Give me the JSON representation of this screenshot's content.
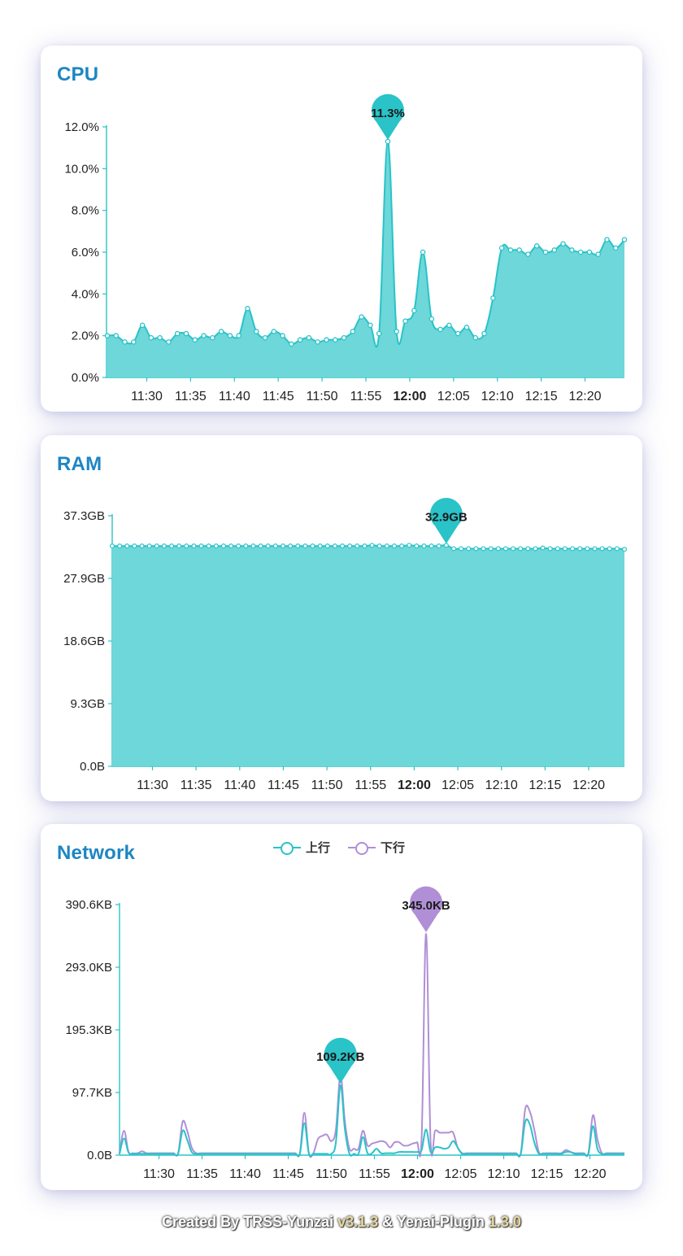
{
  "colors": {
    "cpu": "#29c3c8",
    "ram": "#29c3c8",
    "up": "#29c3c8",
    "down": "#b08fd6",
    "fill": "#6dd7d9",
    "title": "#1d86c3"
  },
  "chart_data": [
    {
      "id": "cpu",
      "type": "area",
      "title": "CPU",
      "xticks": [
        "11:30",
        "11:35",
        "11:40",
        "11:45",
        "11:50",
        "11:55",
        "12:00",
        "12:05",
        "12:10",
        "12:15",
        "12:20"
      ],
      "bold_tick": "12:00",
      "yticks": [
        "0.0%",
        "2.0%",
        "4.0%",
        "6.0%",
        "8.0%",
        "10.0%",
        "12.0%"
      ],
      "ylim": [
        0,
        12
      ],
      "x_start_min": 685.5,
      "x_step_min": 1,
      "values": [
        2.0,
        2.0,
        1.7,
        1.7,
        2.5,
        1.9,
        1.9,
        1.7,
        2.1,
        2.1,
        1.8,
        2.0,
        1.9,
        2.2,
        2.0,
        2.0,
        3.3,
        2.2,
        1.9,
        2.2,
        2.0,
        1.6,
        1.8,
        1.9,
        1.7,
        1.8,
        1.8,
        1.9,
        2.2,
        2.9,
        2.5,
        2.1,
        11.3,
        2.2,
        2.7,
        3.2,
        6.0,
        2.8,
        2.3,
        2.5,
        2.1,
        2.4,
        1.9,
        2.1,
        3.8,
        6.2,
        6.1,
        6.1,
        5.9,
        6.3,
        6.0,
        6.1,
        6.4,
        6.1,
        6.0,
        6.0,
        5.9,
        6.6,
        6.2,
        6.6
      ],
      "peak_label": "11.3%",
      "peak_index": 32,
      "peak_value": 11.3
    },
    {
      "id": "ram",
      "type": "area",
      "title": "RAM",
      "xticks": [
        "11:30",
        "11:35",
        "11:40",
        "11:45",
        "11:50",
        "11:55",
        "12:00",
        "12:05",
        "12:10",
        "12:15",
        "12:20"
      ],
      "bold_tick": "12:00",
      "yticks": [
        "0.0B",
        "9.3GB",
        "18.6GB",
        "27.9GB",
        "37.3GB"
      ],
      "ylim": [
        0,
        37.3
      ],
      "x_start_min": 685.5,
      "x_step_min": 1,
      "values": [
        32.8,
        32.8,
        32.8,
        32.8,
        32.8,
        32.8,
        32.8,
        32.8,
        32.8,
        32.8,
        32.8,
        32.8,
        32.8,
        32.8,
        32.8,
        32.8,
        32.8,
        32.8,
        32.8,
        32.8,
        32.8,
        32.8,
        32.8,
        32.8,
        32.8,
        32.8,
        32.8,
        32.8,
        32.8,
        32.8,
        32.8,
        32.8,
        32.8,
        32.8,
        32.8,
        32.9,
        32.8,
        32.8,
        32.8,
        32.8,
        32.9,
        32.8,
        32.8,
        32.8,
        32.8,
        32.9,
        32.4,
        32.4,
        32.4,
        32.4,
        32.4,
        32.4,
        32.4,
        32.4,
        32.4,
        32.4,
        32.4,
        32.4,
        32.5,
        32.4,
        32.4,
        32.4,
        32.4,
        32.4,
        32.4,
        32.4,
        32.4,
        32.4,
        32.4,
        32.3
      ],
      "peak_label": "32.9GB",
      "peak_index": 45,
      "peak_value": 32.9
    },
    {
      "id": "net",
      "type": "line",
      "title": "Network",
      "legend": [
        {
          "name": "上行",
          "key": "up"
        },
        {
          "name": "下行",
          "key": "down"
        }
      ],
      "xticks": [
        "11:30",
        "11:35",
        "11:40",
        "11:45",
        "11:50",
        "11:55",
        "12:00",
        "12:05",
        "12:10",
        "12:15",
        "12:20"
      ],
      "bold_tick": "12:00",
      "yticks": [
        "0.0B",
        "97.7KB",
        "195.3KB",
        "293.0KB",
        "390.6KB"
      ],
      "ylim": [
        0,
        390.6
      ],
      "x_start_min": 685.5,
      "x_step_min": 0.5,
      "series": [
        {
          "name": "上行",
          "key": "up",
          "values": [
            2,
            26,
            4,
            2,
            2,
            2,
            2,
            2,
            2,
            2,
            2,
            2,
            2,
            2,
            38,
            24,
            5,
            2,
            2,
            2,
            2,
            2,
            2,
            2,
            2,
            2,
            2,
            2,
            2,
            2,
            2,
            2,
            2,
            2,
            2,
            2,
            2,
            2,
            2,
            2,
            2,
            50,
            2,
            2,
            2,
            2,
            2,
            2,
            20,
            109,
            40,
            2,
            2,
            2,
            28,
            3,
            3,
            10,
            3,
            3,
            3,
            3,
            5,
            5,
            5,
            5,
            5,
            8,
            40,
            5,
            12,
            12,
            10,
            12,
            22,
            12,
            2,
            2,
            2,
            2,
            2,
            2,
            2,
            2,
            2,
            2,
            2,
            2,
            2,
            2,
            52,
            48,
            20,
            2,
            2,
            2,
            2,
            2,
            2,
            5,
            5,
            2,
            2,
            2,
            2,
            45,
            10,
            2,
            2,
            2,
            2,
            2,
            2
          ]
        },
        {
          "name": "下行",
          "key": "down",
          "values": [
            3,
            38,
            5,
            3,
            3,
            6,
            3,
            3,
            3,
            3,
            3,
            3,
            3,
            3,
            52,
            38,
            12,
            3,
            3,
            3,
            3,
            3,
            3,
            3,
            3,
            3,
            3,
            3,
            3,
            3,
            3,
            3,
            3,
            3,
            3,
            3,
            3,
            3,
            3,
            3,
            3,
            66,
            3,
            3,
            25,
            30,
            32,
            22,
            40,
            124,
            52,
            10,
            10,
            10,
            38,
            15,
            18,
            20,
            22,
            20,
            12,
            20,
            20,
            15,
            15,
            18,
            20,
            25,
            345,
            20,
            38,
            35,
            35,
            35,
            35,
            12,
            3,
            3,
            3,
            3,
            3,
            3,
            3,
            3,
            3,
            3,
            3,
            3,
            3,
            3,
            72,
            68,
            40,
            5,
            3,
            3,
            3,
            3,
            3,
            8,
            5,
            3,
            3,
            3,
            3,
            62,
            25,
            3,
            3,
            3,
            3,
            3,
            3
          ]
        }
      ],
      "peak_labels": [
        {
          "label": "109.2KB",
          "series": "up",
          "index": 49,
          "value": 109.2
        },
        {
          "label": "345.0KB",
          "series": "down",
          "index": 68,
          "value": 345.0
        }
      ]
    }
  ],
  "footer": {
    "prefix": "Created By TRSS-Yunzai ",
    "v1": "v3.1.3",
    "mid": "  & Yenai-Plugin ",
    "v2": "1.3.0"
  }
}
